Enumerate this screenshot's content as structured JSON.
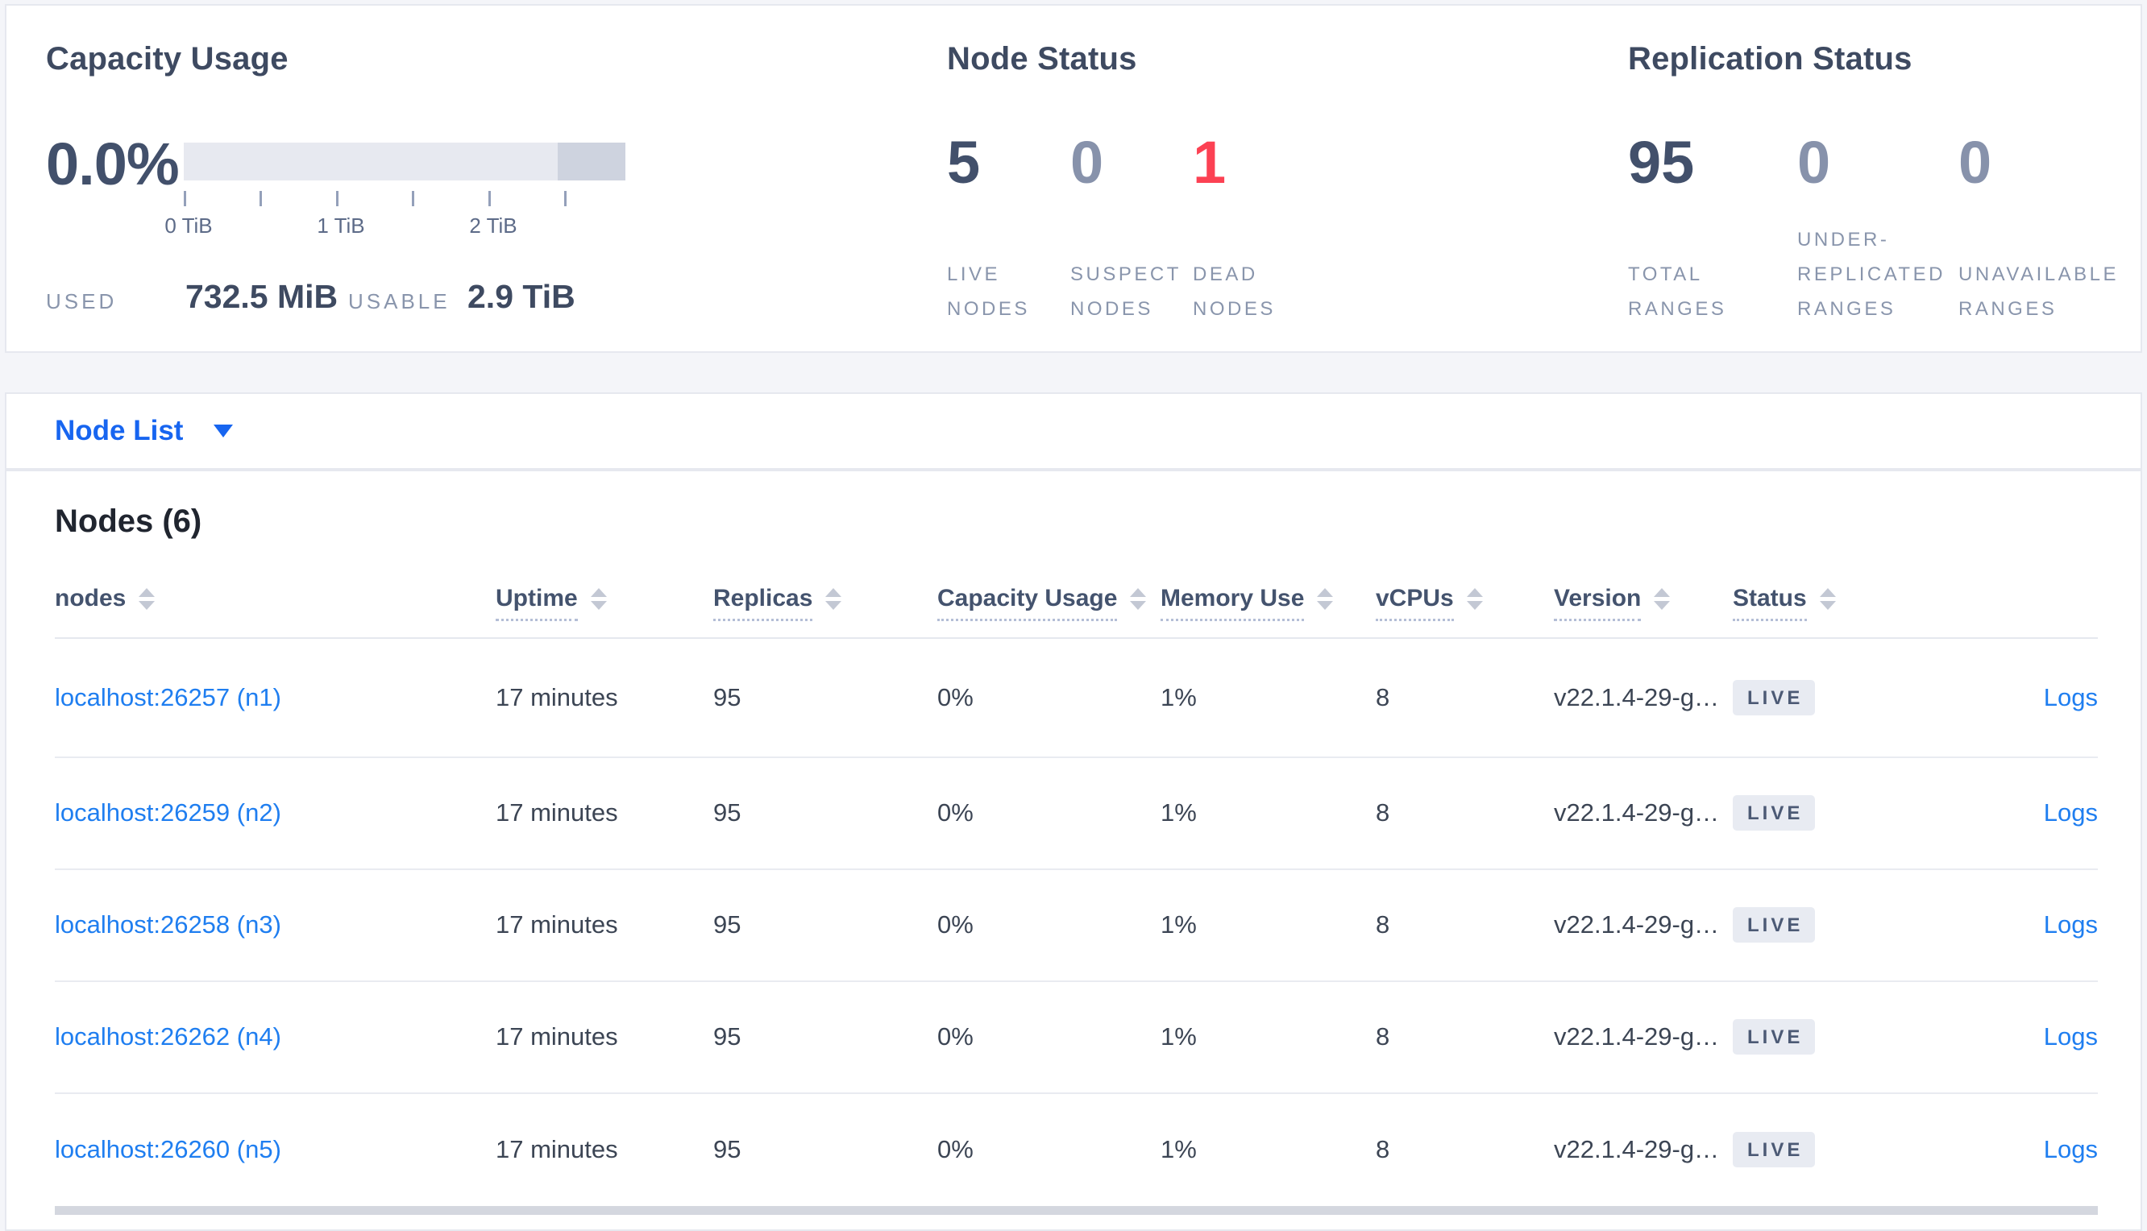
{
  "summary": {
    "capacity": {
      "title": "Capacity Usage",
      "percent": "0.0%",
      "ticks": [
        "0 TiB",
        "1 TiB",
        "2 TiB"
      ],
      "used_label": "USED",
      "used_value": "732.5 MiB",
      "usable_label": "USABLE",
      "usable_value": "2.9 TiB"
    },
    "node_status": {
      "title": "Node Status",
      "stats": [
        {
          "value": "5",
          "label": "LIVE NODES"
        },
        {
          "value": "0",
          "label": "SUSPECT NODES"
        },
        {
          "value": "1",
          "label": "DEAD NODES"
        }
      ]
    },
    "replication": {
      "title": "Replication Status",
      "stats": [
        {
          "value": "95",
          "label": "TOTAL RANGES"
        },
        {
          "value": "0",
          "label": "UNDER-REPLICATED RANGES"
        },
        {
          "value": "0",
          "label": "UNAVAILABLE RANGES"
        }
      ]
    }
  },
  "view_selector": {
    "label": "Node List"
  },
  "nodes_section": {
    "title": "Nodes (6)",
    "columns": [
      "nodes",
      "Uptime",
      "Replicas",
      "Capacity Usage",
      "Memory Use",
      "vCPUs",
      "Version",
      "Status"
    ],
    "logs_label": "Logs",
    "rows": [
      {
        "address": "localhost:26257 (n1)",
        "uptime": "17 minutes",
        "replicas": "95",
        "capacity_usage": "0%",
        "memory_use": "1%",
        "vcpus": "8",
        "version": "v22.1.4-29-g…",
        "status": "LIVE"
      },
      {
        "address": "localhost:26259 (n2)",
        "uptime": "17 minutes",
        "replicas": "95",
        "capacity_usage": "0%",
        "memory_use": "1%",
        "vcpus": "8",
        "version": "v22.1.4-29-g…",
        "status": "LIVE"
      },
      {
        "address": "localhost:26258 (n3)",
        "uptime": "17 minutes",
        "replicas": "95",
        "capacity_usage": "0%",
        "memory_use": "1%",
        "vcpus": "8",
        "version": "v22.1.4-29-g…",
        "status": "LIVE"
      },
      {
        "address": "localhost:26262 (n4)",
        "uptime": "17 minutes",
        "replicas": "95",
        "capacity_usage": "0%",
        "memory_use": "1%",
        "vcpus": "8",
        "version": "v22.1.4-29-g…",
        "status": "LIVE"
      },
      {
        "address": "localhost:26260 (n5)",
        "uptime": "17 minutes",
        "replicas": "95",
        "capacity_usage": "0%",
        "memory_use": "1%",
        "vcpus": "8",
        "version": "v22.1.4-29-g…",
        "status": "LIVE"
      }
    ]
  },
  "colors": {
    "link_blue": "#1f7ef0",
    "selector_blue": "#1765f0",
    "dead_red": "#fc4153",
    "slate_dark": "#42506b",
    "muted_number": "#8792ab",
    "bar_light": "#e7e9f0",
    "bar_dark": "#ced3df",
    "badge_bg": "#e8ebf2"
  }
}
